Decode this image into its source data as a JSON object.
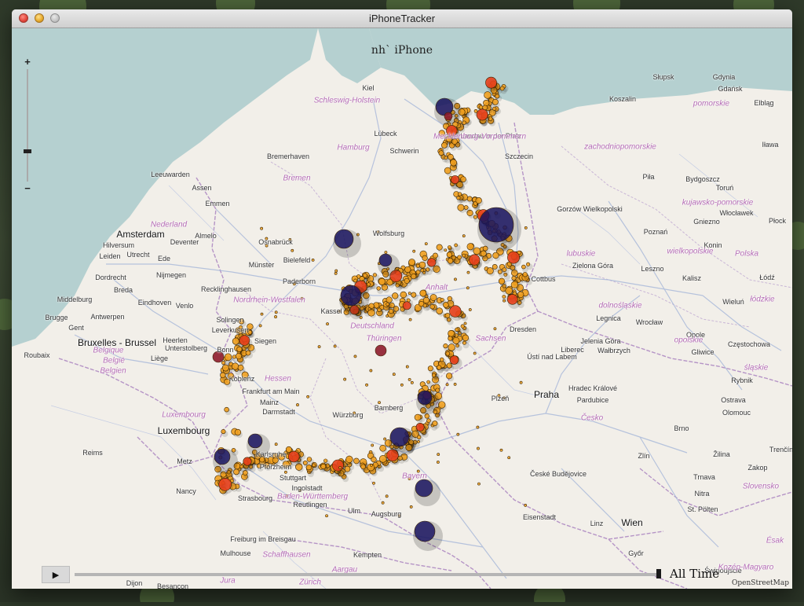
{
  "window": {
    "title": "iPhoneTracker"
  },
  "device_label": "nh` iPhone",
  "zoom": {
    "plus": "+",
    "minus": "−",
    "level_fraction": 0.17
  },
  "timeline": {
    "play_icon": "▶",
    "label": "All Time",
    "position_fraction": 1.0
  },
  "attribution": "OpenStreetMap",
  "colors": {
    "sea": "#b5d0d0",
    "land": "#f2efe9",
    "border": "#b594c6",
    "road": "#a7b7d9",
    "dot_small": "#f0a020",
    "dot_medium": "#e8401c",
    "dot_large": "#1a1560"
  },
  "map_labels": {
    "city": [
      "Kiel",
      "Lübeck",
      "Schwerin",
      "Bremerhaven",
      "Leeuwarden",
      "Assen",
      "Emmen",
      "Almelo",
      "Deventer",
      "Osnabrück",
      "Bielefeld",
      "Münster",
      "Paderborn",
      "Hilversum",
      "Leiden",
      "Utrecht",
      "Ede",
      "Dordrecht",
      "Nijmegen",
      "Breda",
      "Middelburg",
      "Eindhoven",
      "Venlo",
      "Recklinghausen",
      "Brugge",
      "Antwerpen",
      "Gent",
      "Solingen",
      "Leverkusen",
      "Bonn",
      "Heerlen",
      "Unterstolberg",
      "Roubaix",
      "Liège",
      "Siegen",
      "Kassel",
      "Koblenz",
      "Frankfurt am Main",
      "Mainz",
      "Darmstadt",
      "Würzburg",
      "Bamberg",
      "Metz",
      "Reims",
      "Nancy",
      "Strasbourg",
      "Reutlingen",
      "Ulm",
      "Augsburg",
      "Freiburg im Breisgau",
      "Mulhouse",
      "Kempten",
      "Dijon",
      "Besançon",
      "Wolfsburg",
      "Cottbus",
      "Dresden",
      "Ústí nad Labem",
      "Liberec",
      "Plzeň",
      "Hradec Králové",
      "Pardubice",
      "České Budějovice",
      "Jelenia Góra",
      "Wałbrzych",
      "Legnica",
      "Wrocław",
      "Zielona Góra",
      "Gorzów Wielkopolski",
      "Szczecin",
      "Koszalin",
      "Słupsk",
      "Gdynia",
      "Gdańsk",
      "Elbląg",
      "Iława",
      "Piła",
      "Bydgoszcz",
      "Toruń",
      "Włocławek",
      "Gniezno",
      "Poznań",
      "Konin",
      "Płock",
      "Leszno",
      "Kalisz",
      "Łódź",
      "Wieluń",
      "Opole",
      "Częstochowa",
      "Gliwice",
      "Rybnik",
      "Ostrava",
      "Olomouc",
      "Brno",
      "Zlín",
      "Žilina",
      "Zakop",
      "Trenčín",
      "Trnava",
      "Nitra",
      "St. Pölten",
      "Linz",
      "Eisenstadt",
      "Győr",
      "Świnoujście",
      "Landau in der Pfalz",
      "Karlsruhe",
      "Pforzheim",
      "Stuttgart",
      "Ingolstadt"
    ],
    "big_city": [
      "Amsterdam",
      "Bruxelles - Brussel",
      "Luxembourg",
      "Praha",
      "Wien"
    ],
    "region": [
      "Schleswig-Holstein",
      "Hamburg",
      "Bremen",
      "Nederland",
      "Mecklenburg-Vorpommern",
      "zachodniopomorskie",
      "pomorskie",
      "kujawsko-pomorskie",
      "lubuskie",
      "wielkopolskie",
      "Polska",
      "Anhalt",
      "Nordrhein-Westfalen",
      "Deutschland",
      "Thüringen",
      "Sachsen",
      "dolnośląskie",
      "łódzkie",
      "opolskie",
      "śląskie",
      "Belgique",
      "België",
      "Belgien",
      "Hessen",
      "Luxembourg",
      "Bayern",
      "Baden-Württemberg",
      "Česko",
      "Slovensko",
      "Ésak",
      "Kozép-Magyaro",
      "Schaffhausen",
      "Aargau",
      "Jura",
      "Zürich"
    ]
  }
}
